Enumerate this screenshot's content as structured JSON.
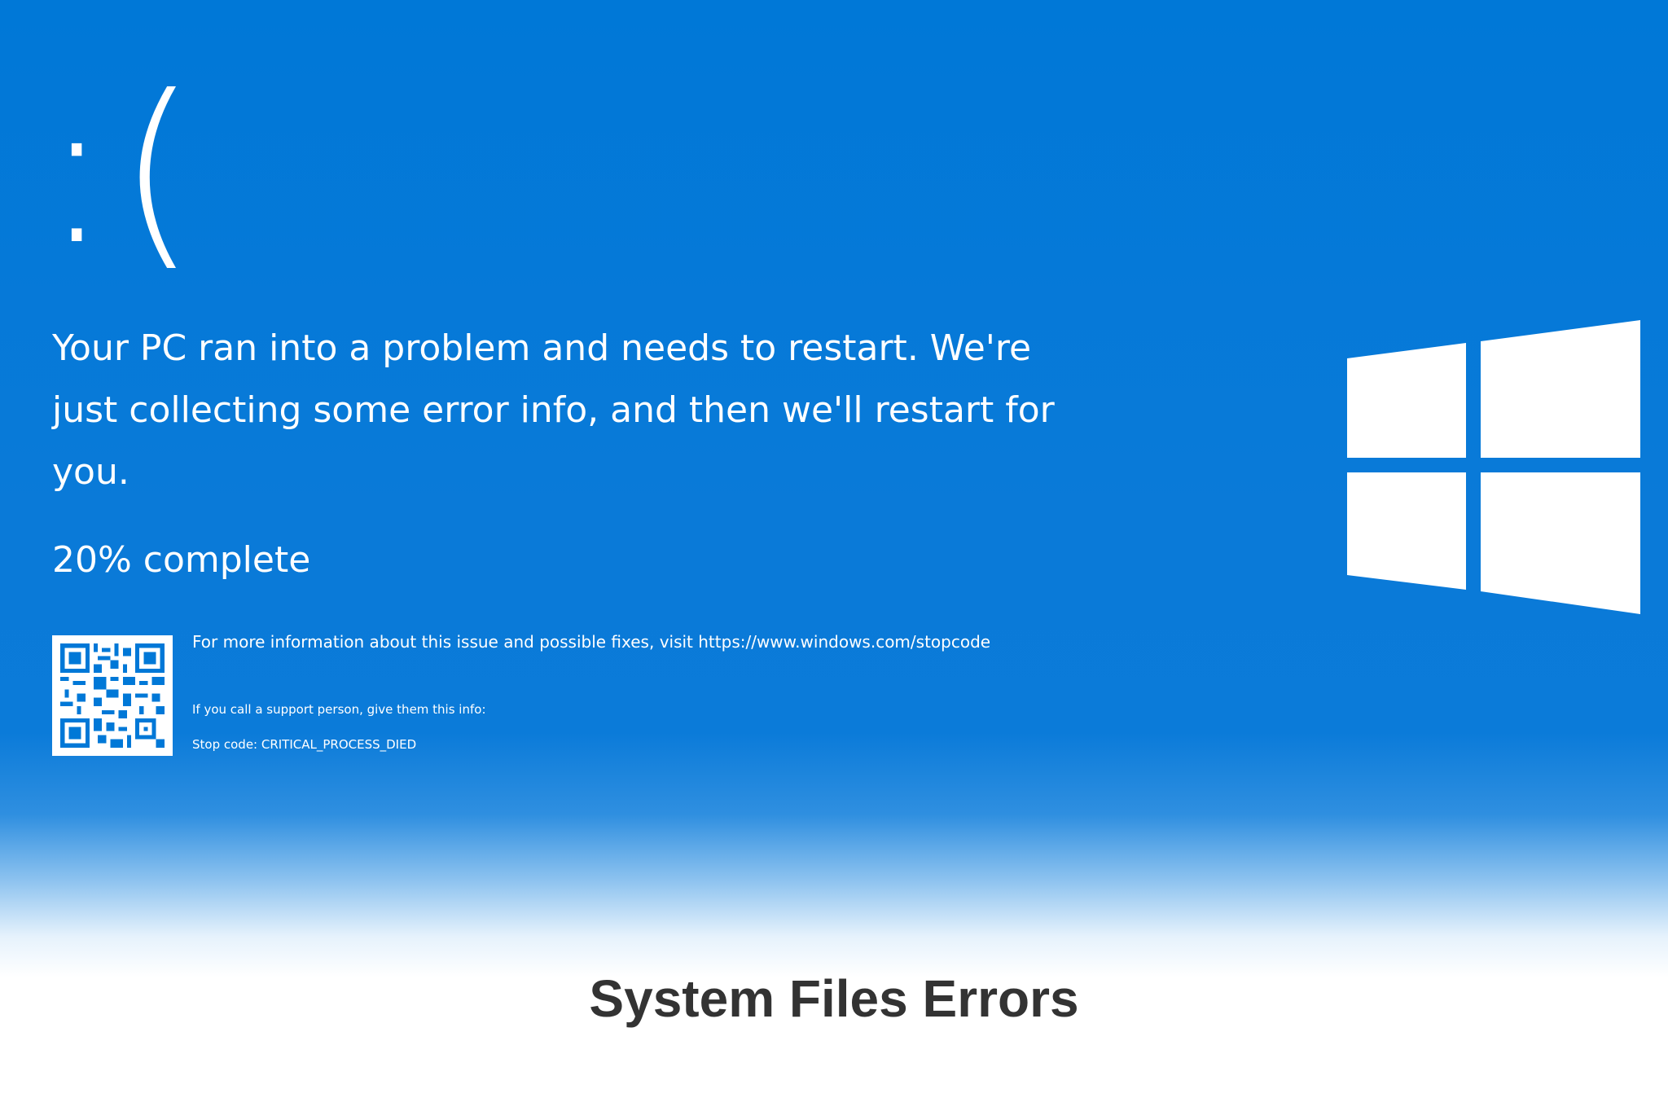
{
  "bsod": {
    "face": ":(",
    "message": "Your PC ran into a problem and needs to restart. We're just collecting some error info, and then we'll restart for you.",
    "progress_text": "20% complete",
    "more_info": "For more information about this issue and possible fixes, visit https://www.windows.com/stopcode",
    "support_info": "If you call a support person, give them this info:",
    "stop_code": "Stop code: CRITICAL_PROCESS_DIED",
    "qr_icon": "qr-code-icon",
    "logo_icon": "windows-logo-icon"
  },
  "caption": {
    "title": "System Files Errors"
  },
  "colors": {
    "background": "#0078d7",
    "text": "#ffffff",
    "caption_text": "#333333"
  }
}
